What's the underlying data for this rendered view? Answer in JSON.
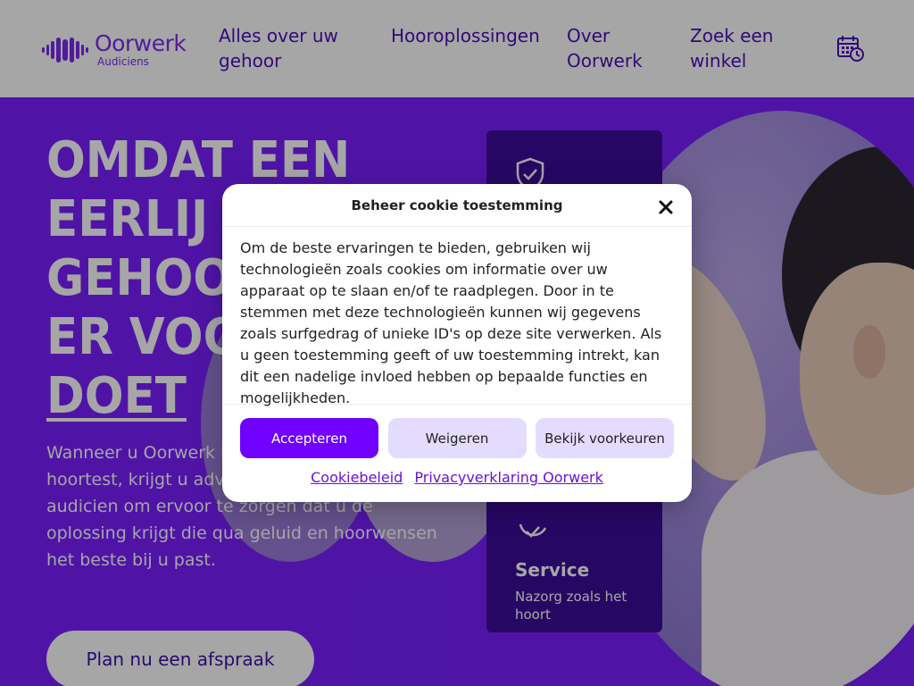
{
  "header": {
    "logo": {
      "name": "Oorwerk",
      "sub": "Audiciens"
    },
    "nav": [
      {
        "label": "Alles over uw gehoor"
      },
      {
        "label": "Hooroplossingen"
      },
      {
        "label": "Over Oorwerk"
      },
      {
        "label": "Zoek een winkel"
      }
    ],
    "calendar_icon": "calendar-clock-icon"
  },
  "hero": {
    "headline": [
      "Omdat een",
      "eerlijk",
      "gehoor",
      "er voor",
      "doet"
    ],
    "headline_visible": [
      "OMDAT EEN",
      "EERLIJ",
      "GEHOOR",
      "ER VOO",
      "DOET"
    ],
    "intro": "Wanneer u Oorwerk b... hoortest, krijgt u adv... audicien om ervoor te zorgen dat u de oplossing krijgt die qua geluid en hoorwensen het beste bij u past.",
    "intro_lines": [
      "Wanneer u Oorwerk b",
      "hoortest, krijgt u adv",
      "audicien om ervoor te zorgen dat u de",
      "oplossing krijgt die qua geluid en hoorwensen",
      "het beste bij u past."
    ],
    "cta_label": "Plan nu een afspraak",
    "card": {
      "title": "Service",
      "subtitle": "Nazorg zoals het hoort"
    }
  },
  "cookie_modal": {
    "title": "Beheer cookie toestemming",
    "body": "Om de beste ervaringen te bieden, gebruiken wij technologieën zoals cookies om informatie over uw apparaat op te slaan en/of te raadplegen. Door in te stemmen met deze technologieën kunnen wij gegevens zoals surfgedrag of unieke ID's op deze site verwerken. Als u geen toestemming geeft of uw toestemming intrekt, kan dit een nadelige invloed hebben op bepaalde functies en mogelijkheden.",
    "accept_label": "Accepteren",
    "deny_label": "Weigeren",
    "prefs_label": "Bekijk voorkeuren",
    "link_cookie": "Cookiebeleid",
    "link_privacy": "Privacyverklaring Oorwerk"
  },
  "colors": {
    "brand_purple": "#7a20ff",
    "accept_button": "#7000ff",
    "secondary_button": "#e4dcff",
    "nav_text": "#4a0fb8"
  }
}
